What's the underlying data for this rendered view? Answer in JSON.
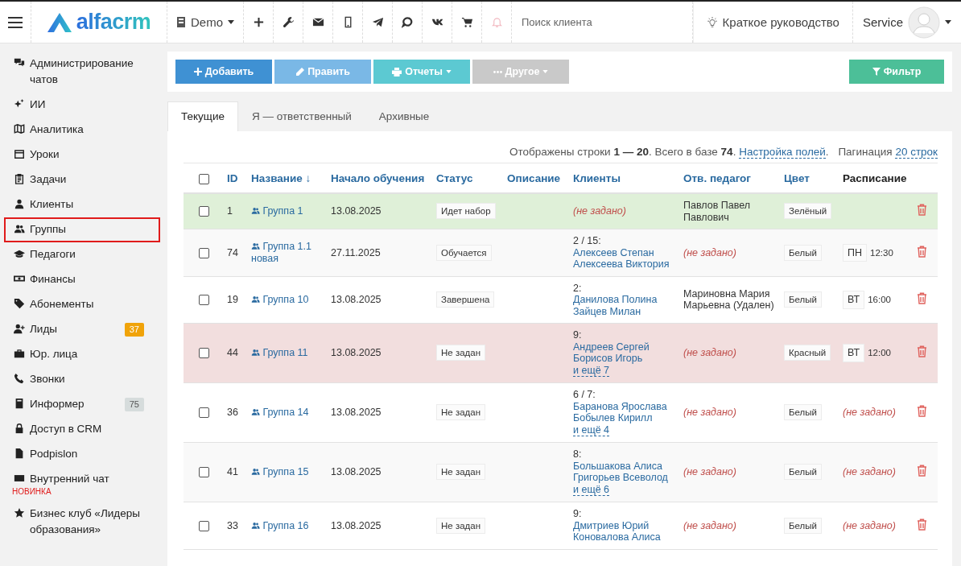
{
  "header": {
    "logo": "alfacrm",
    "branch": "Demo",
    "search": {
      "placeholder": "Поиск клиента"
    },
    "guide": "Краткое руководство",
    "user": "Service"
  },
  "sidebar": {
    "items": [
      {
        "label": "Администрирование чатов",
        "selected": false
      },
      {
        "label": "ИИ",
        "selected": false
      },
      {
        "label": "Аналитика",
        "selected": false
      },
      {
        "label": "Уроки",
        "selected": false
      },
      {
        "label": "Задачи",
        "selected": false
      },
      {
        "label": "Клиенты",
        "selected": false
      },
      {
        "label": "Группы",
        "selected": true
      },
      {
        "label": "Педагоги",
        "selected": false
      },
      {
        "label": "Финансы",
        "selected": false
      },
      {
        "label": "Абонементы",
        "selected": false
      },
      {
        "label": "Лиды",
        "selected": false,
        "badge": "37",
        "color": "#f0a30a"
      },
      {
        "label": "Юр. лица",
        "selected": false
      },
      {
        "label": "Звонки",
        "selected": false
      },
      {
        "label": "Информер",
        "selected": false,
        "badge": "75",
        "color": "#d6dcdc"
      },
      {
        "label": "Доступ в CRM",
        "selected": false
      },
      {
        "label": "Podpislon",
        "selected": false
      },
      {
        "label": "Внутренний чат",
        "selected": false,
        "note": "НОВИНКА"
      },
      {
        "label": "Бизнес клуб «Лидеры образования»",
        "selected": false
      }
    ]
  },
  "toolbar": {
    "buttons": [
      {
        "label": "Добавить",
        "kind": "add",
        "color": "#3f91d3"
      },
      {
        "label": "Править",
        "kind": "edit",
        "color": "#7ab8e6"
      },
      {
        "label": "Отчеты",
        "kind": "reports",
        "color": "#5cc9d2"
      },
      {
        "label": "Другое",
        "kind": "other",
        "color": "#c9c9c9"
      }
    ],
    "filter": {
      "label": "Фильтр",
      "color": "#4cbf98"
    }
  },
  "tabs": [
    {
      "label": "Текущие",
      "selected": true
    },
    {
      "label": "Я — ответственный",
      "selected": false
    },
    {
      "label": "Архивные",
      "selected": false
    }
  ],
  "summary": {
    "text": "Отображены строки **1 — 20**. Всего в базе **74**.",
    "fields_link": "Настройка полей",
    "separator": ".",
    "pagination_label": "Пагинация",
    "pagination_link": "20 строк"
  },
  "table": {
    "select_all_checked": false,
    "columns": [
      {
        "label": "ID",
        "sortable": true
      },
      {
        "label": "Название ↓",
        "sortable": true
      },
      {
        "label": "Начало обучения",
        "sortable": true
      },
      {
        "label": "Статус",
        "sortable": true
      },
      {
        "label": "Описание",
        "sortable": true
      },
      {
        "label": "Клиенты",
        "sortable": true
      },
      {
        "label": "Отв. педагог",
        "sortable": true
      },
      {
        "label": "Цвет",
        "sortable": true
      },
      {
        "label": "Расписание",
        "sortable": false
      }
    ],
    "rows": [
      {
        "checked": false,
        "color": "#dff0d8",
        "id": "1",
        "name": "Группа 1",
        "start": "13.08.2025",
        "status": "Идет набор",
        "clients": {
          "kind": "empty",
          "text": "(не задано)"
        },
        "teacher": {
          "kind": "text",
          "text": "Павлов Павел Павлович"
        },
        "tag": "Зелёный",
        "schedule": {
          "kind": "none"
        }
      },
      {
        "checked": false,
        "id": "74",
        "name": "Группа 1.1 новая",
        "start": "27.11.2025",
        "status": "Обучается",
        "clients": {
          "kind": "list",
          "count": "2 / 15:",
          "names": [
            "Алексеев Степан",
            "Алексеева Виктория"
          ]
        },
        "teacher": {
          "kind": "empty",
          "text": "(не задано)"
        },
        "tag": "Белый",
        "schedule": {
          "kind": "slot",
          "day": "ПН",
          "time": "12:30"
        }
      },
      {
        "checked": false,
        "id": "19",
        "name": "Группа 10",
        "start": "13.08.2025",
        "status": "Завершена",
        "clients": {
          "kind": "list",
          "count": "2:",
          "names": [
            "Данилова Полина",
            "Зайцев Милан"
          ]
        },
        "teacher": {
          "kind": "text",
          "text": "Мариновна Мария Марьевна (Удален)"
        },
        "tag": "Белый",
        "schedule": {
          "kind": "slot",
          "day": "ВТ",
          "time": "16:00"
        }
      },
      {
        "checked": false,
        "color": "#f2dede",
        "id": "44",
        "name": "Группа 11",
        "start": "13.08.2025",
        "status": "Не задан",
        "clients": {
          "kind": "list",
          "count": "9:",
          "names": [
            "Андреев Сергей",
            "Борисов Игорь"
          ],
          "more": "и ещё 7"
        },
        "teacher": {
          "kind": "empty",
          "text": "(не задано)"
        },
        "tag": "Красный",
        "schedule": {
          "kind": "slot",
          "day": "ВТ",
          "time": "12:00"
        }
      },
      {
        "checked": false,
        "id": "36",
        "name": "Группа 14",
        "start": "13.08.2025",
        "status": "Не задан",
        "clients": {
          "kind": "list",
          "count": "6 / 7:",
          "names": [
            "Баранова Ярослава",
            "Бобылев Кирилл"
          ],
          "more": "и ещё 4"
        },
        "teacher": {
          "kind": "empty",
          "text": "(не задано)"
        },
        "tag": "Белый",
        "schedule": {
          "kind": "empty",
          "text": "(не задано)"
        }
      },
      {
        "checked": false,
        "id": "41",
        "name": "Группа 15",
        "start": "13.08.2025",
        "status": "Не задан",
        "clients": {
          "kind": "list",
          "count": "8:",
          "names": [
            "Большакова Алиса",
            "Григорьев Всеволод"
          ],
          "more": "и ещё 6"
        },
        "teacher": {
          "kind": "empty",
          "text": "(не задано)"
        },
        "tag": "Белый",
        "schedule": {
          "kind": "empty",
          "text": "(не задано)"
        }
      },
      {
        "checked": false,
        "id": "33",
        "name": "Группа 16",
        "start": "13.08.2025",
        "status": "Не задан",
        "clients": {
          "kind": "list",
          "count": "9:",
          "names": [
            "Дмитриев Юрий",
            "Коновалова Алиса"
          ]
        },
        "teacher": {
          "kind": "empty",
          "text": "(не задано)"
        },
        "tag": "Белый",
        "schedule": {
          "kind": "empty",
          "text": "(не задано)"
        }
      }
    ]
  }
}
